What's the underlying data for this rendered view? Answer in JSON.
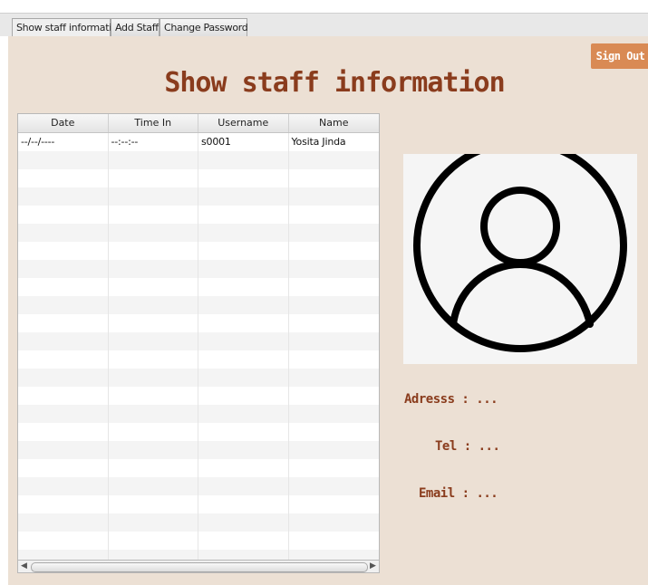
{
  "tabs": [
    {
      "label": "Show staff information",
      "active": true
    },
    {
      "label": "Add Staff",
      "active": false
    },
    {
      "label": "Change Password",
      "active": false
    }
  ],
  "header": {
    "title": "Show staff information",
    "signout_label": "Sign Out"
  },
  "table": {
    "columns": [
      "Date",
      "Time In",
      "Username",
      "Name"
    ],
    "rows": [
      [
        "--/--/----",
        "--:--:--",
        "s0001",
        "Yosita Jinda"
      ]
    ]
  },
  "profile": {
    "address_label": "Adresss :",
    "address_value": "...",
    "tel_label": "Tel :",
    "tel_value": "...",
    "email_label": "Email :",
    "email_value": "..."
  },
  "icons": {
    "photo": "user-avatar-icon",
    "scroll_left": "chevron-left-icon",
    "scroll_right": "chevron-right-icon"
  },
  "colors": {
    "background": "#ece0d4",
    "accent": "#8a3c1d",
    "button": "#d98a54"
  }
}
